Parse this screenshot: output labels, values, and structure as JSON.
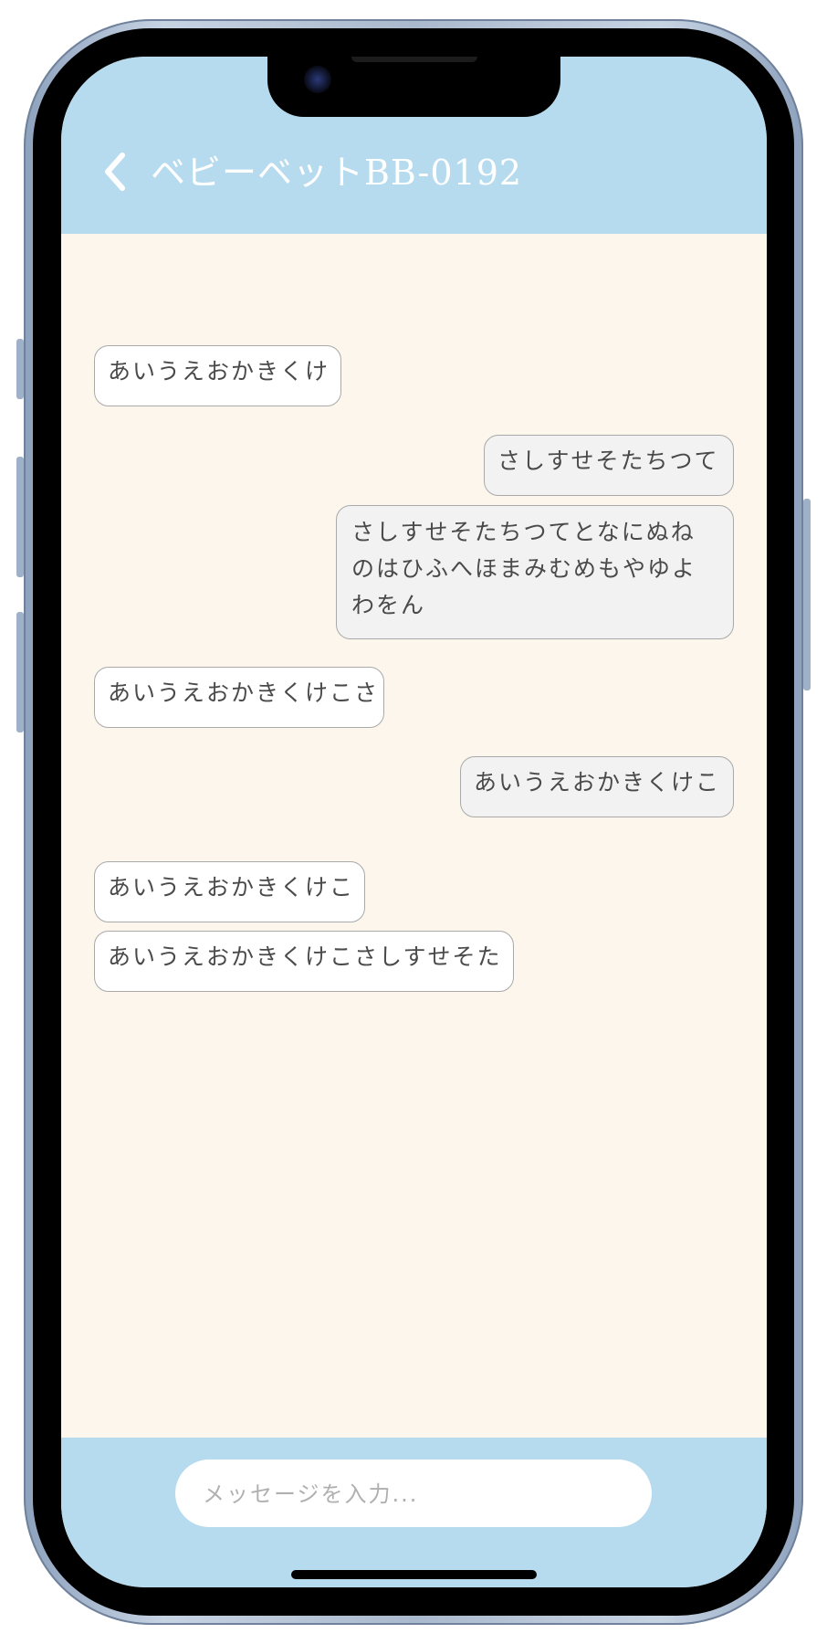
{
  "header": {
    "title": "ベビーベットBB-0192",
    "back_icon": "chevron-left-icon",
    "background_color": "#b7dbee"
  },
  "messages": [
    {
      "sender": "other",
      "text": "あいうえおかきくけ"
    },
    {
      "sender": "self",
      "text": "さしすせそたちつて"
    },
    {
      "sender": "self",
      "text": "さしすせそたちつてとなにぬねのはひふへほまみむめもやゆよわをん"
    },
    {
      "sender": "other",
      "text": "あいうえおかきくけこさ"
    },
    {
      "sender": "self",
      "text": "あいうえおかきくけこ"
    },
    {
      "sender": "other",
      "text": "あいうえおかきくけこ"
    },
    {
      "sender": "other",
      "text": "あいうえおかきくけこさしすせそた"
    }
  ],
  "composer": {
    "placeholder": "メッセージを入力...",
    "value": ""
  },
  "colors": {
    "chat_background": "#fcf6ec",
    "incoming_bubble": "#ffffff",
    "outgoing_bubble": "#f2f2f2",
    "bubble_border": "#a9a9a9"
  }
}
